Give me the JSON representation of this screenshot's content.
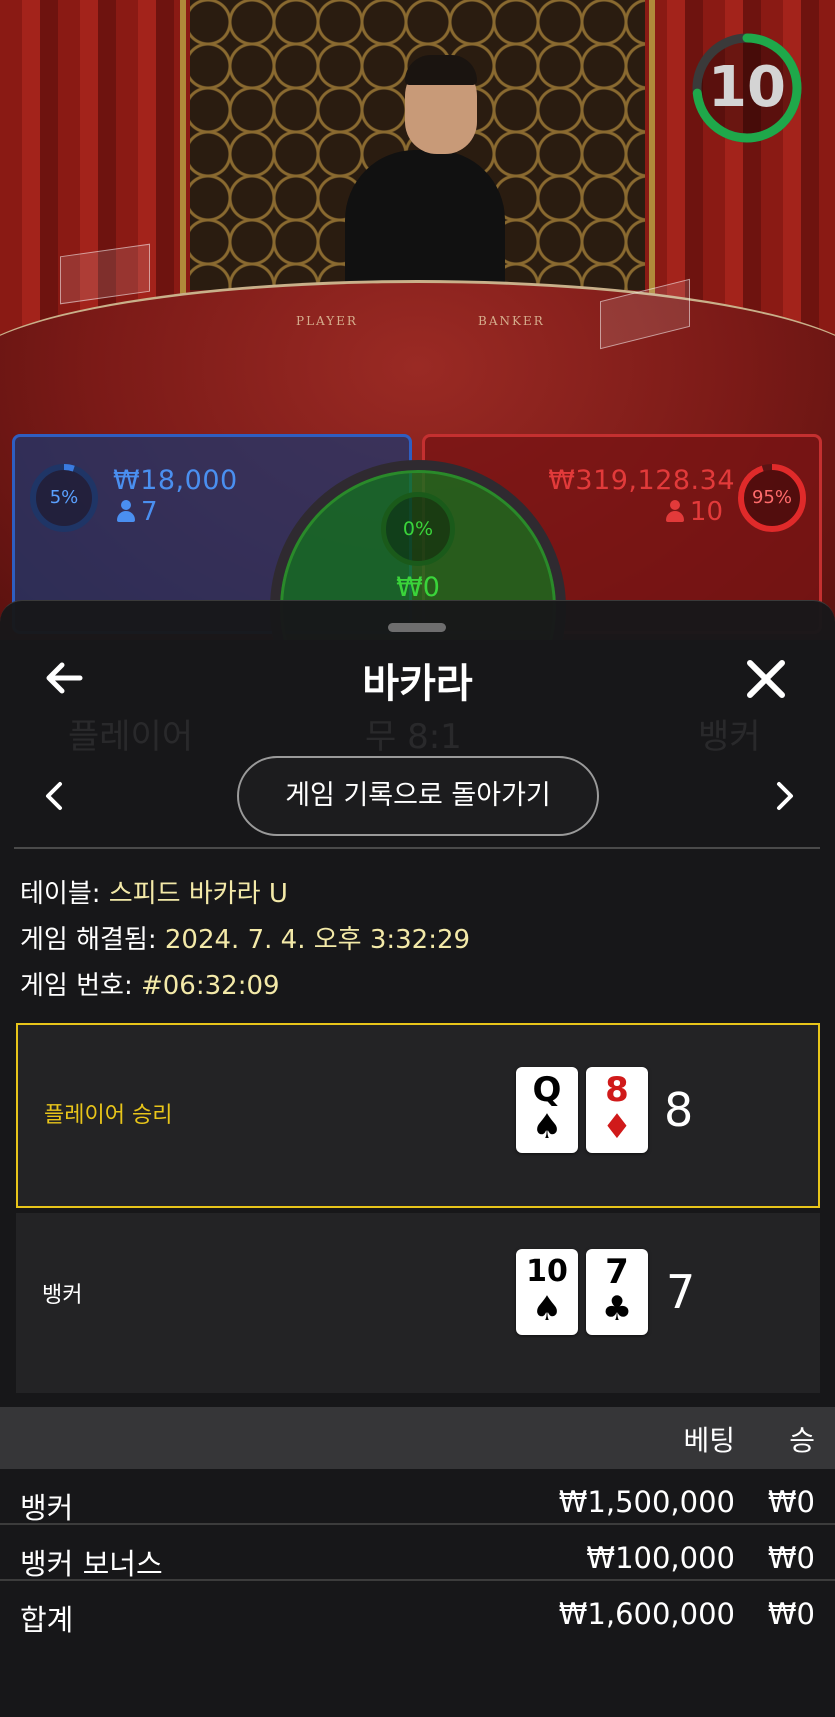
{
  "live_table": {
    "timer": "10",
    "player_zone": {
      "percent": "5%",
      "amount": "₩18,000",
      "count": "7"
    },
    "banker_zone": {
      "percent": "95%",
      "amount": "₩319,128.34",
      "count": "10"
    },
    "tie_zone": {
      "percent": "0%",
      "amount": "₩0"
    },
    "table_labels": {
      "player": "PLAYER",
      "banker": "BANKER"
    },
    "colors": {
      "player": "#2f6fd6",
      "banker": "#d42828",
      "tie": "#2aa52a",
      "timer_ring": "#1fa84a"
    }
  },
  "sheet": {
    "title": "바카라",
    "back_to_history": "게임 기록으로 돌아가기",
    "info": {
      "table_label": "테이블:",
      "table_value": "스피드 바카라 U",
      "resolved_label": "게임 해결됨:",
      "resolved_value": "2024. 7. 4. 오후 3:32:29",
      "number_label": "게임 번호:",
      "number_value": "#06:32:09"
    },
    "hands": {
      "player": {
        "label": "플레이어 승리",
        "score": "8",
        "cards": [
          {
            "rank": "Q",
            "suit": "♠"
          },
          {
            "rank": "8",
            "suit": "♦"
          }
        ]
      },
      "banker": {
        "label": "뱅커",
        "score": "7",
        "cards": [
          {
            "rank": "10",
            "suit": "♠"
          },
          {
            "rank": "7",
            "suit": "♣"
          }
        ]
      }
    },
    "bets": {
      "header_bet": "베팅",
      "header_win": "승",
      "rows": [
        {
          "name": "뱅커",
          "amount": "₩1,500,000",
          "win": "₩0"
        },
        {
          "name": "뱅커 보너스",
          "amount": "₩100,000",
          "win": "₩0"
        },
        {
          "name": "합계",
          "amount": "₩1,600,000",
          "win": "₩0"
        }
      ]
    },
    "accent_color": "#e8c51a"
  }
}
